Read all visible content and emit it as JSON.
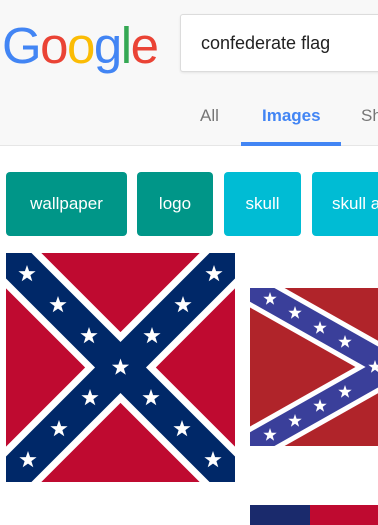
{
  "logo": {
    "text": "Google"
  },
  "search": {
    "value": "confederate flag"
  },
  "tabs": [
    {
      "label": "All"
    },
    {
      "label": "Images",
      "active": true
    },
    {
      "label": "Sh"
    }
  ],
  "chips": [
    {
      "label": "wallpaper",
      "color": "#009688"
    },
    {
      "label": "logo",
      "color": "#009688"
    },
    {
      "label": "skull",
      "color": "#00bcd4"
    },
    {
      "label": "skull a",
      "color": "#00bcd4"
    }
  ],
  "results": [
    {
      "image": "confederate-flag-square"
    },
    {
      "image": "confederate-flag-stretched"
    },
    {
      "image": "confederate-flag-partial"
    }
  ],
  "colors": {
    "accent": "#4285f4",
    "flag_red": "#bf0a30",
    "flag_blue": "#002868"
  }
}
